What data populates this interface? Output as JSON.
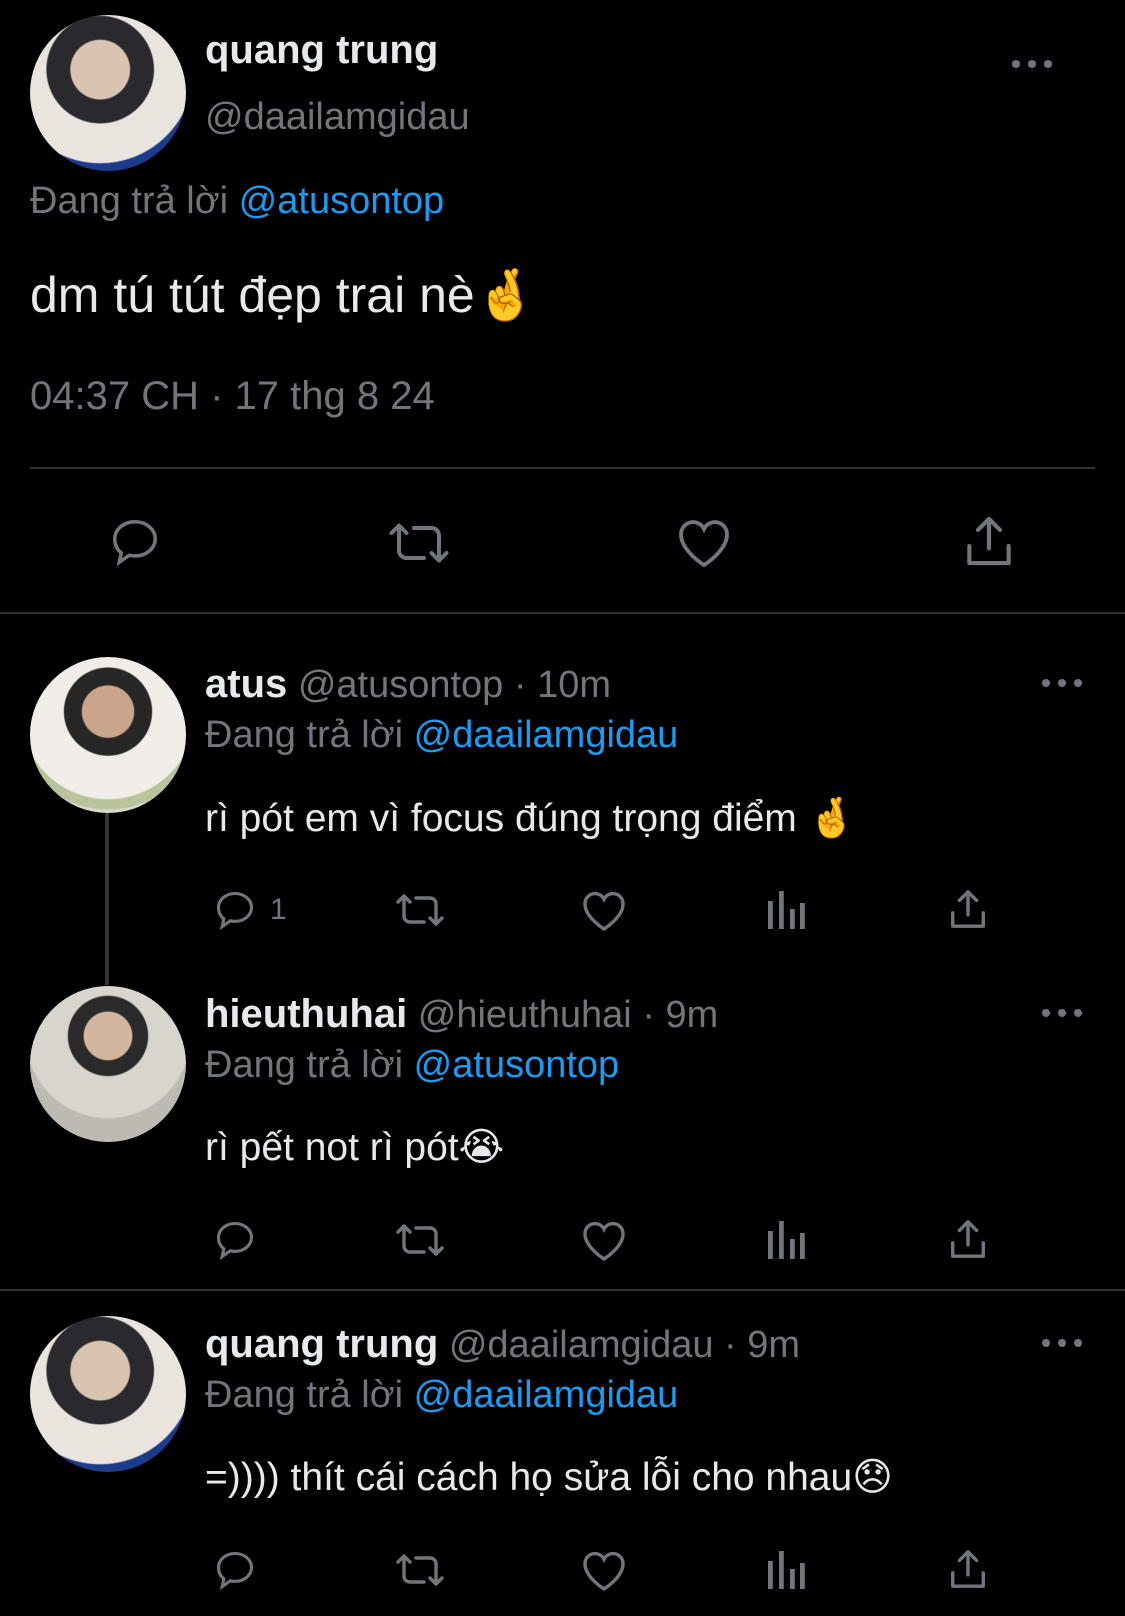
{
  "main_tweet": {
    "display_name": "quang trung",
    "handle": "@daailamgidau",
    "reply_prefix": "Đang trả lời",
    "reply_to": "@atusontop",
    "text": "dm tú tút đẹp trai nè🤞",
    "timestamp": "04:37 CH · 17 thg 8 24",
    "actions": [
      "reply-icon",
      "retweet-icon",
      "like-icon",
      "share-icon"
    ]
  },
  "replies": [
    {
      "display_name": "atus",
      "handle": "@atusontop",
      "time": "10m",
      "reply_prefix": "Đang trả lời",
      "reply_to": "@daailamgidau",
      "text": "rì pót em vì focus đúng trọng điểm 🤞",
      "reply_count": "1"
    },
    {
      "display_name": "hieuthuhai",
      "handle": "@hieuthuhai",
      "time": "9m",
      "reply_prefix": "Đang trả lời",
      "reply_to": "@atusontop",
      "text": "rì pết not rì pót😭",
      "reply_count": ""
    },
    {
      "display_name": "quang trung",
      "handle": "@daailamgidau",
      "time": "9m",
      "reply_prefix": "Đang trả lời",
      "reply_to": "@daailamgidau",
      "text": "=)))) thít cái cách họ sửa lỗi cho nhau😞",
      "reply_count": ""
    }
  ],
  "separator": "·",
  "colors": {
    "background": "#000000",
    "text": "#e7e9ea",
    "muted": "#71767b",
    "link": "#1d9bf0",
    "divider": "#2f3336"
  }
}
